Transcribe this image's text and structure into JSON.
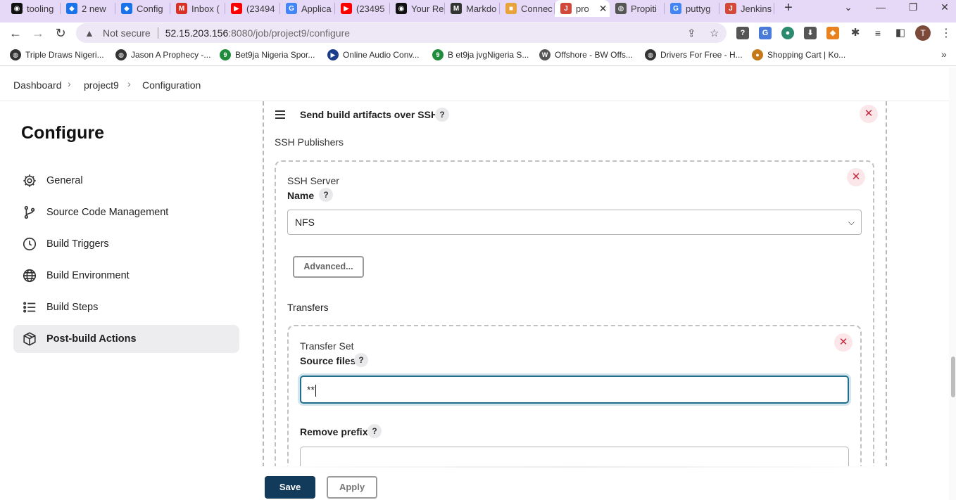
{
  "browser": {
    "tabs": [
      {
        "title": "tooling",
        "icon": "github-icon",
        "color": "#111111"
      },
      {
        "title": "2 new",
        "icon": "app-icon",
        "color": "#1a73e8"
      },
      {
        "title": "Config",
        "icon": "app-icon",
        "color": "#1a73e8"
      },
      {
        "title": "Inbox (",
        "icon": "gmail-icon",
        "color": "#d93025"
      },
      {
        "title": "(23494",
        "icon": "youtube-icon",
        "color": "#ff0000"
      },
      {
        "title": "Applica",
        "icon": "google-icon",
        "color": "#4285f4"
      },
      {
        "title": "(23495",
        "icon": "youtube-icon",
        "color": "#ff0000"
      },
      {
        "title": "Your Re",
        "icon": "github-icon",
        "color": "#111111"
      },
      {
        "title": "Markdo",
        "icon": "markdown-icon",
        "color": "#333333"
      },
      {
        "title": "Connec",
        "icon": "box-icon",
        "color": "#e8a33d"
      },
      {
        "title": "pro",
        "icon": "jenkins-icon",
        "color": "#d24939",
        "active": true
      },
      {
        "title": "Propiti",
        "icon": "globe-icon",
        "color": "#555555"
      },
      {
        "title": "puttyg",
        "icon": "google-icon",
        "color": "#4285f4"
      },
      {
        "title": "Jenkins",
        "icon": "jenkins-icon",
        "color": "#d24939"
      }
    ],
    "url_prefix": "Not secure",
    "url_host": "52.15.203.156",
    "url_path": ":8080/job/project9/configure",
    "profile_initial": "T",
    "bookmarks": [
      {
        "label": "Triple Draws Nigeri...",
        "icon": "globe-icon"
      },
      {
        "label": "Jason A Prophecy -...",
        "icon": "globe-icon"
      },
      {
        "label": "Bet9ja Nigeria Spor...",
        "icon": "bet9ja-icon"
      },
      {
        "label": "Online Audio Conv...",
        "icon": "play-icon"
      },
      {
        "label": "B et9ja jvgNigeria S...",
        "icon": "bet9ja-icon"
      },
      {
        "label": "Offshore - BW Offs...",
        "icon": "offshore-icon"
      },
      {
        "label": "Drivers For Free - H...",
        "icon": "globe-icon"
      },
      {
        "label": "Shopping Cart | Ko...",
        "icon": "cart-icon"
      }
    ]
  },
  "breadcrumb": [
    "Dashboard",
    "project9",
    "Configuration"
  ],
  "sidebar": {
    "title": "Configure",
    "items": [
      {
        "label": "General",
        "icon": "gear-icon"
      },
      {
        "label": "Source Code Management",
        "icon": "branch-icon"
      },
      {
        "label": "Build Triggers",
        "icon": "clock-icon"
      },
      {
        "label": "Build Environment",
        "icon": "globe-icon"
      },
      {
        "label": "Build Steps",
        "icon": "list-icon"
      },
      {
        "label": "Post-build Actions",
        "icon": "cube-icon",
        "active": true
      }
    ]
  },
  "main": {
    "section_title": "Send build artifacts over SSH",
    "publishers_label": "SSH Publishers",
    "server_heading": "SSH Server",
    "name_label": "Name",
    "name_value": "NFS",
    "advanced_button": "Advanced...",
    "transfers_label": "Transfers",
    "transfer_heading": "Transfer Set",
    "source_files_label": "Source files",
    "source_files_value": "**",
    "remove_prefix_label": "Remove prefix",
    "remove_prefix_value": "",
    "help_glyph": "?"
  },
  "footer": {
    "save_label": "Save",
    "apply_label": "Apply"
  },
  "colors": {
    "tabstrip": "#e6d9f7",
    "save_button": "#123a5a",
    "focus_border": "#1f6f8b",
    "close_red": "#c4293b"
  }
}
